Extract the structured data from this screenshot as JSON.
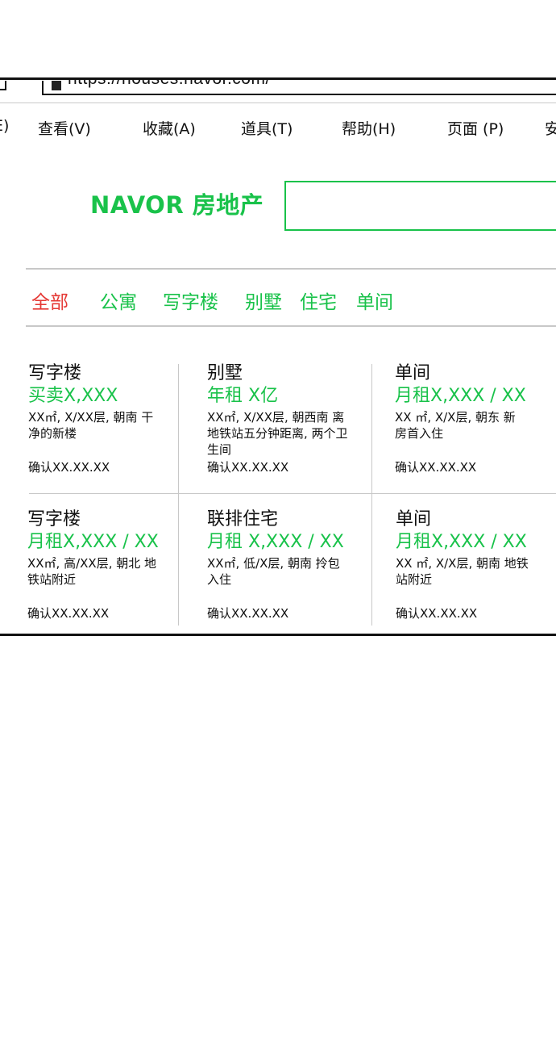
{
  "browser": {
    "url": "https://houses.navor.com/",
    "menu": [
      {
        "label": "E)"
      },
      {
        "label": "查看(V)"
      },
      {
        "label": "收藏(A)"
      },
      {
        "label": "道具(T)"
      },
      {
        "label": "帮助(H)"
      },
      {
        "label": "页面 (P)"
      },
      {
        "label": "安"
      }
    ]
  },
  "site": {
    "logo": "NAVOR 房地产",
    "search_value": "",
    "accent_color": "#19c24a",
    "active_color": "#e53935"
  },
  "categories": [
    {
      "label": "全部",
      "active": true
    },
    {
      "label": "公寓"
    },
    {
      "label": "写字楼"
    },
    {
      "label": "别墅"
    },
    {
      "label": "住宅"
    },
    {
      "label": "单间"
    }
  ],
  "listings": [
    {
      "title": "写字楼",
      "price": "买卖X,XXX",
      "desc": "XX㎡, X/XX层, 朝南 干净的新楼",
      "date": "确认XX.XX.XX"
    },
    {
      "title": "别墅",
      "price": "年租 X亿",
      "desc": "XX㎡, X/XX层, 朝西南 离地铁站五分钟距离, 两个卫生间",
      "date": "确认XX.XX.XX"
    },
    {
      "title": "单间",
      "price": "月租X,XXX / XX",
      "desc": "XX ㎡, X/X层, 朝东 新房首入住",
      "date": "确认XX.XX.XX"
    },
    {
      "title": "写字楼",
      "price": "月租X,XXX / XX",
      "desc": "XX㎡, 高/XX层, 朝北 地铁站附近",
      "date": "确认XX.XX.XX"
    },
    {
      "title": "联排住宅",
      "price": "月租 X,XXX / XX",
      "desc": "XX㎡, 低/X层, 朝南 拎包入住",
      "date": "确认XX.XX.XX"
    },
    {
      "title": "单间",
      "price": "月租X,XXX / XX",
      "desc": "XX ㎡, X/X层, 朝南 地铁站附近",
      "date": "确认XX.XX.XX"
    }
  ]
}
